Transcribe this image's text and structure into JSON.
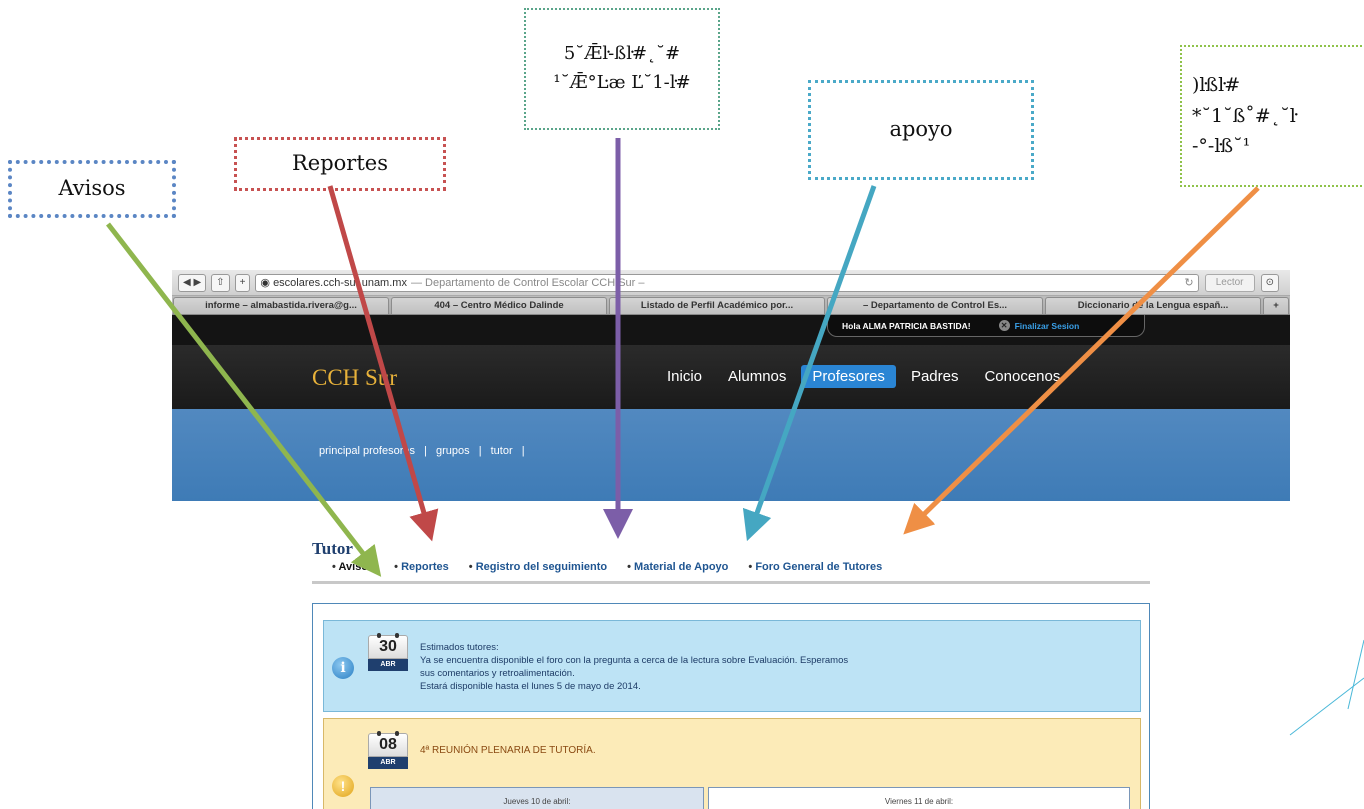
{
  "callouts": {
    "avisos": "Avisos",
    "reportes": "Reportes",
    "registro_line1": "5˘Ǣŀ-ßŀ#˛˘#",
    "registro_line2": "¹˘Ǣ°Ŀæ Ľ˘1-ŀ#",
    "apoyo": "apoyo",
    "foro_line1": ")ŀßŀ#",
    "foro_line2": "*˘1˘ß˚#˛˘ŀ",
    "foro_line3": "-°-ŀß˘¹"
  },
  "browser": {
    "url_host": "escolares.cch-sur.unam.mx",
    "url_title": "— Departamento de Control Escolar CCH Sur –",
    "lector": "Lector",
    "tabs": [
      "informe – almabastida.rivera@g...",
      "404 – Centro Médico Dalinde",
      "Listado de Perfil Académico por...",
      "– Departamento de Control Es...",
      "Diccionario de la Lengua españ..."
    ]
  },
  "site": {
    "greeting": "Hola ALMA PATRICIA BASTIDA!",
    "logout": "Finalizar Sesion",
    "logo": "CCH Sur",
    "menu": [
      "Inicio",
      "Alumnos",
      "Profesores",
      "Padres",
      "Conocenos"
    ],
    "active_menu": "Profesores",
    "subnav": [
      "principal profesores",
      "|",
      "grupos",
      "|",
      "tutor",
      "|"
    ]
  },
  "tutor": {
    "title": "Tutor",
    "tabs": [
      "Avisos",
      "Reportes",
      "Registro del seguimiento",
      "Material de Apoyo",
      "Foro General de Tutores"
    ],
    "notice1": {
      "day": "30",
      "month": "ABR",
      "lines": [
        "Estimados tutores:",
        "Ya se encuentra disponible el foro con la pregunta a cerca de la lectura sobre Evaluación. Esperamos",
        "sus comentarios y retroalimentación.",
        "Estará disponible hasta el lunes 5 de mayo de 2014."
      ]
    },
    "notice2": {
      "day": "08",
      "month": "ABR",
      "title": "4ª REUNIÓN PLENARIA DE TUTORÍA.",
      "thursday": "Jueves 10 de abril:",
      "friday": "Viernes 11 de abril:"
    }
  }
}
